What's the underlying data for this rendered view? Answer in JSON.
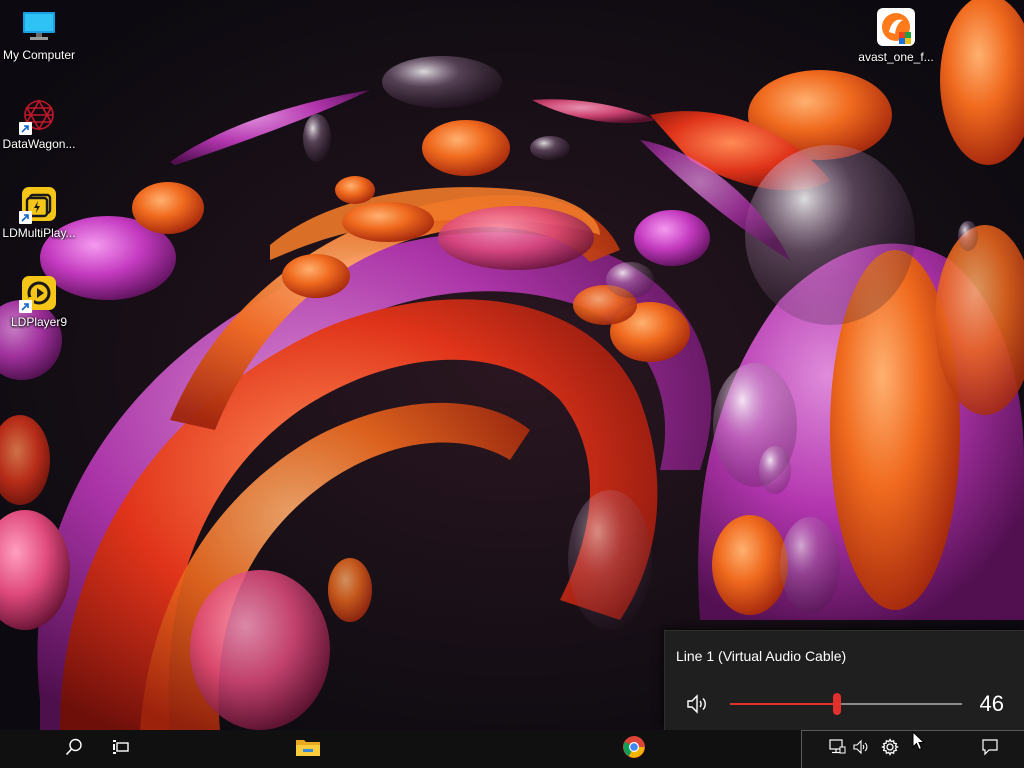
{
  "desktop": {
    "icons": [
      {
        "label": "My Computer",
        "icon": "monitor-icon"
      },
      {
        "label": "DataWagon...",
        "icon": "datawagon-icon",
        "shortcut": true
      },
      {
        "label": "LDMultiPlay...",
        "icon": "ldmultiplayer-icon",
        "shortcut": true
      },
      {
        "label": "LDPlayer9",
        "icon": "ldplayer-icon",
        "shortcut": true
      },
      {
        "label": "avast_one_f...",
        "icon": "avast-icon"
      }
    ]
  },
  "volume_flyout": {
    "device_name": "Line 1 (Virtual Audio Cable)",
    "volume": 46,
    "volume_label": "46",
    "speaker_icon": "speaker-icon",
    "accent_color": "#e2312b"
  },
  "taskbar": {
    "buttons": [
      {
        "name": "search",
        "icon": "search-icon"
      },
      {
        "name": "task-view",
        "icon": "task-view-icon"
      },
      {
        "name": "file-explorer",
        "icon": "folder-icon"
      },
      {
        "name": "chrome",
        "icon": "chrome-icon"
      }
    ],
    "tray": [
      {
        "name": "network",
        "icon": "network-icon"
      },
      {
        "name": "volume",
        "icon": "speaker-icon"
      },
      {
        "name": "settings",
        "icon": "gear-icon"
      },
      {
        "name": "action-center",
        "icon": "notification-icon"
      }
    ]
  }
}
